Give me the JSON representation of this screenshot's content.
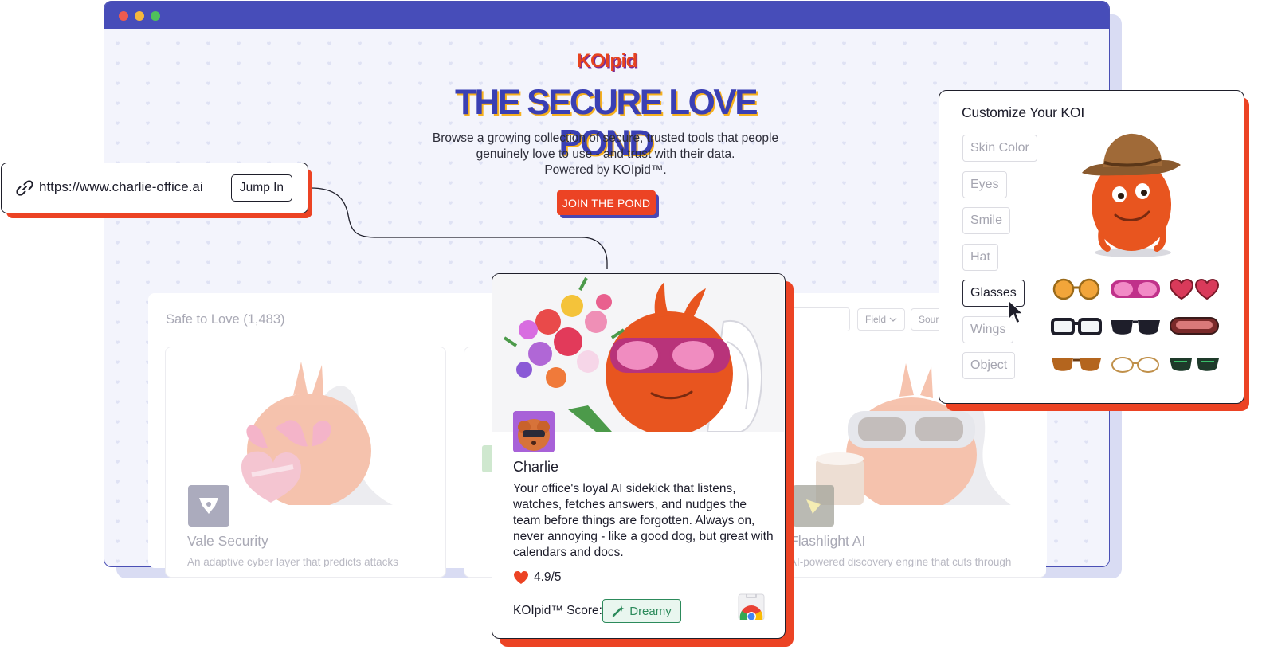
{
  "window": {
    "dots": [
      "close",
      "minimize",
      "maximize"
    ]
  },
  "hero": {
    "logo": "KOIpid",
    "title": "THE SECURE LOVE POND",
    "description_line1": "Browse a growing collection of secure, trusted tools that people",
    "description_line2": "genuinely love to use - and trust with their data.",
    "description_line3": "Powered by KOIpid™.",
    "cta": "JOIN THE POND"
  },
  "listing": {
    "title": "Safe to Love (1,483)",
    "filter_field": "Field",
    "filter_source": "Sour",
    "cards": [
      {
        "name": "Vale Security",
        "desc": "An adaptive cyber layer that predicts attacks"
      },
      {
        "name": "Flashlight AI",
        "desc": "AI-powered discovery engine that cuts through"
      }
    ]
  },
  "url_bar": {
    "url": "https://www.charlie-office.ai",
    "button": "Jump In"
  },
  "featured": {
    "name": "Charlie",
    "description": "Your office's loyal AI sidekick that listens, watches, fetches answers, and nudges the team before things are forgotten. Always on, never annoying - like a good dog, but great with calendars and docs.",
    "rating": "4.9/5",
    "score_label": "KOIpid™ Score:",
    "score_value": "Dreamy"
  },
  "customize": {
    "title": "Customize Your KOI",
    "options": [
      "Skin Color",
      "Eyes",
      "Smile",
      "Hat",
      "Glasses",
      "Wings",
      "Object"
    ],
    "selected": "Glasses"
  },
  "colors": {
    "accent_red": "#ec4324",
    "brand_blue": "#474db9",
    "score_green": "#2c8a5b"
  }
}
